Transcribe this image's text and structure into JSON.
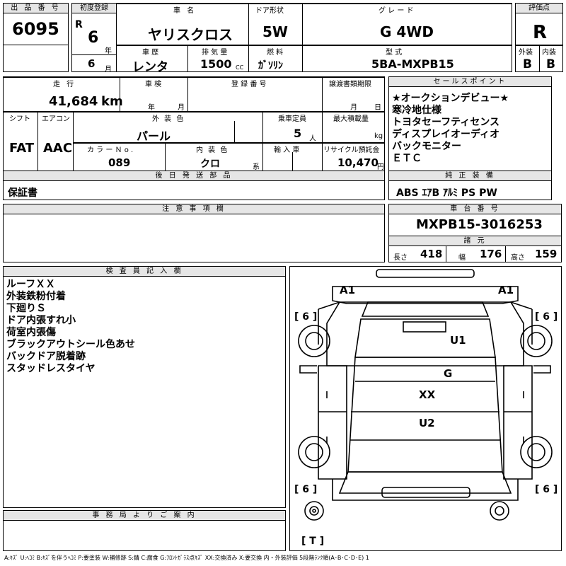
{
  "lot": {
    "label": "出 品 番 号",
    "value": "6095"
  },
  "first_reg": {
    "label": "初度登録",
    "era": "R",
    "year": "6",
    "year_unit": "年",
    "month": "6",
    "month_unit": "月"
  },
  "car_name": {
    "label": "車  名",
    "value": "ヤリスクロス"
  },
  "door": {
    "label": "ドア形状",
    "value": "5W"
  },
  "grade": {
    "label": "グ レ ー ド",
    "value": "G 4WD"
  },
  "score": {
    "label": "評価点",
    "value": "R"
  },
  "history": {
    "label": "車 歴",
    "value": "レンタ"
  },
  "displacement": {
    "label": "排 気 量",
    "value": "1500",
    "unit": "CC"
  },
  "fuel": {
    "label": "燃  料",
    "value": "ｶﾞｿﾘﾝ"
  },
  "model": {
    "label": "型  式",
    "value": "5BA-MXPB15"
  },
  "exterior": {
    "label": "外装",
    "value": "B"
  },
  "interior": {
    "label": "内装",
    "value": "B"
  },
  "mileage": {
    "label": "走 行",
    "value": "41,684",
    "unit": "km"
  },
  "inspection": {
    "label": "車 検",
    "year_unit": "年",
    "month_unit": "月"
  },
  "plate": {
    "label": "登 録 番 号"
  },
  "transfer_doc": {
    "label": "譲渡書類期限",
    "month_unit": "月",
    "day_unit": "日"
  },
  "shift": {
    "label": "シフト",
    "value": "FAT"
  },
  "aircon": {
    "label": "エアコン",
    "value": "AAC"
  },
  "ext_color": {
    "label": "外 装 色",
    "value": "パール"
  },
  "capacity": {
    "label": "乗車定員",
    "value": "5",
    "unit": "人"
  },
  "max_load": {
    "label": "最大積載量",
    "unit": "kg"
  },
  "color_no": {
    "label": "カ ラ ー Ｎ o .",
    "value": "089"
  },
  "int_color": {
    "label": "内 装 色",
    "value": "クロ",
    "unit": "系"
  },
  "import": {
    "label": "輸 入 車"
  },
  "recycle": {
    "label": "リサイクル預託金",
    "value": "10,470",
    "unit": "円"
  },
  "sales_points": {
    "label": "セールスポイント",
    "items": [
      "★オークションデビュー★",
      "寒冷地仕様",
      "トヨタセーフティセンス",
      "ディスプレイオーディオ",
      "バックモニター",
      "ＥＴＣ"
    ]
  },
  "later_parts": {
    "label": "後 日 発 送 部 品",
    "value": "保証書"
  },
  "equipment": {
    "label": "純 正 装 備",
    "value": "ABS ｴｱB ｱﾙﾐ PS PW"
  },
  "notes": {
    "label": "注 意 事 項 欄"
  },
  "chassis": {
    "label": "車 台 番 号",
    "value": "MXPB15-3016253"
  },
  "dims": {
    "label": "諸 元",
    "length_label": "長さ",
    "length": "418",
    "width_label": "幅",
    "width": "176",
    "height_label": "高さ",
    "height": "159"
  },
  "inspector": {
    "label": "検 査 員 記 入 欄",
    "items": [
      "ルーフＸＸ",
      "外装鉄粉付着",
      "下廻りＳ",
      "ドア内張すれ小",
      "荷室内張傷",
      "ブラックアウトシール色あせ",
      "バックドア脱着跡",
      "スタッドレスタイヤ"
    ]
  },
  "office": {
    "label": "事 務 局 よ り ご 案 内"
  },
  "diagram": {
    "tire_fl": "6",
    "tire_fr": "6",
    "tire_rl": "6",
    "tire_rr": "6",
    "a1_left": "A1",
    "a1_right": "A1",
    "u1": "U1",
    "g": "G",
    "xx": "XX",
    "u2": "U2",
    "spare": "T"
  },
  "legend": "A:ｷｽﾞ U:ﾍｺﾐ B:ｷｽﾞを伴うﾍｺﾐ P:要塗装 W:補修跡 S:錆 C:腐食 G:ﾌﾛﾝﾄｶﾞﾗｽ点ｷｽﾞ XX:交換済み X:要交換 内・外装評価 5段階ﾗﾝｸ順(A･B･C･D･E) 1"
}
